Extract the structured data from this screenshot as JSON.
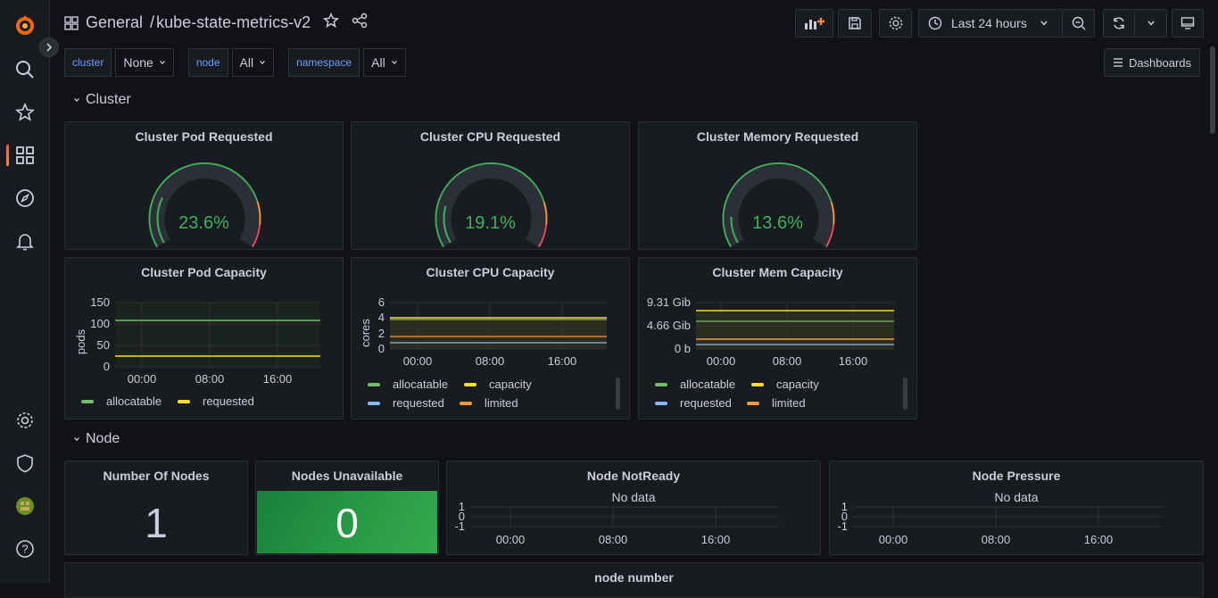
{
  "header": {
    "folder": "General",
    "separator": "/",
    "title": "kube-state-metrics-v2",
    "time_range": "Last 24 hours",
    "dashboards_button": "Dashboards"
  },
  "variables": [
    {
      "label": "cluster",
      "value": "None"
    },
    {
      "label": "node",
      "value": "All"
    },
    {
      "label": "namespace",
      "value": "All"
    }
  ],
  "rows": {
    "cluster": "Cluster",
    "node": "Node"
  },
  "gauges": [
    {
      "title": "Cluster Pod Requested",
      "value": "23.6%",
      "fraction": 0.236
    },
    {
      "title": "Cluster CPU Requested",
      "value": "19.1%",
      "fraction": 0.191
    },
    {
      "title": "Cluster Memory Requested",
      "value": "13.6%",
      "fraction": 0.136
    }
  ],
  "capacity": {
    "pod": {
      "title": "Cluster Pod Capacity",
      "ylabel": "pods",
      "yticks": [
        "150",
        "100",
        "50",
        "0"
      ],
      "xticks": [
        "00:00",
        "08:00",
        "16:00"
      ],
      "legend": [
        {
          "name": "allocatable",
          "color": "#73bf69"
        },
        {
          "name": "requested",
          "color": "#fade2a"
        }
      ]
    },
    "cpu": {
      "title": "Cluster CPU Capacity",
      "ylabel": "cores",
      "yticks": [
        "6",
        "4",
        "2",
        "0"
      ],
      "xticks": [
        "00:00",
        "08:00",
        "16:00"
      ],
      "legend": [
        {
          "name": "allocatable",
          "color": "#73bf69"
        },
        {
          "name": "capacity",
          "color": "#fade2a"
        },
        {
          "name": "requested",
          "color": "#8ab8ff"
        },
        {
          "name": "limited",
          "color": "#ff9830"
        }
      ]
    },
    "mem": {
      "title": "Cluster Mem Capacity",
      "yticks": [
        "9.31 Gib",
        "4.66 Gib",
        "0 b"
      ],
      "xticks": [
        "00:00",
        "08:00",
        "16:00"
      ],
      "legend": [
        {
          "name": "allocatable",
          "color": "#73bf69"
        },
        {
          "name": "capacity",
          "color": "#fade2a"
        },
        {
          "name": "requested",
          "color": "#8ab8ff"
        },
        {
          "name": "limited",
          "color": "#ff9830"
        }
      ]
    }
  },
  "node_panels": {
    "nodes": {
      "title": "Number Of Nodes",
      "value": "1"
    },
    "unavailable": {
      "title": "Nodes Unavailable",
      "value": "0"
    },
    "notready": {
      "title": "Node NotReady",
      "nodata": "No data",
      "yticks": [
        "1",
        "0",
        "-1"
      ],
      "xticks": [
        "00:00",
        "08:00",
        "16:00"
      ]
    },
    "pressure": {
      "title": "Node Pressure",
      "nodata": "No data",
      "yticks": [
        "1",
        "0",
        "-1"
      ],
      "xticks": [
        "00:00",
        "08:00",
        "16:00"
      ]
    },
    "number": {
      "title": "node number"
    }
  }
}
